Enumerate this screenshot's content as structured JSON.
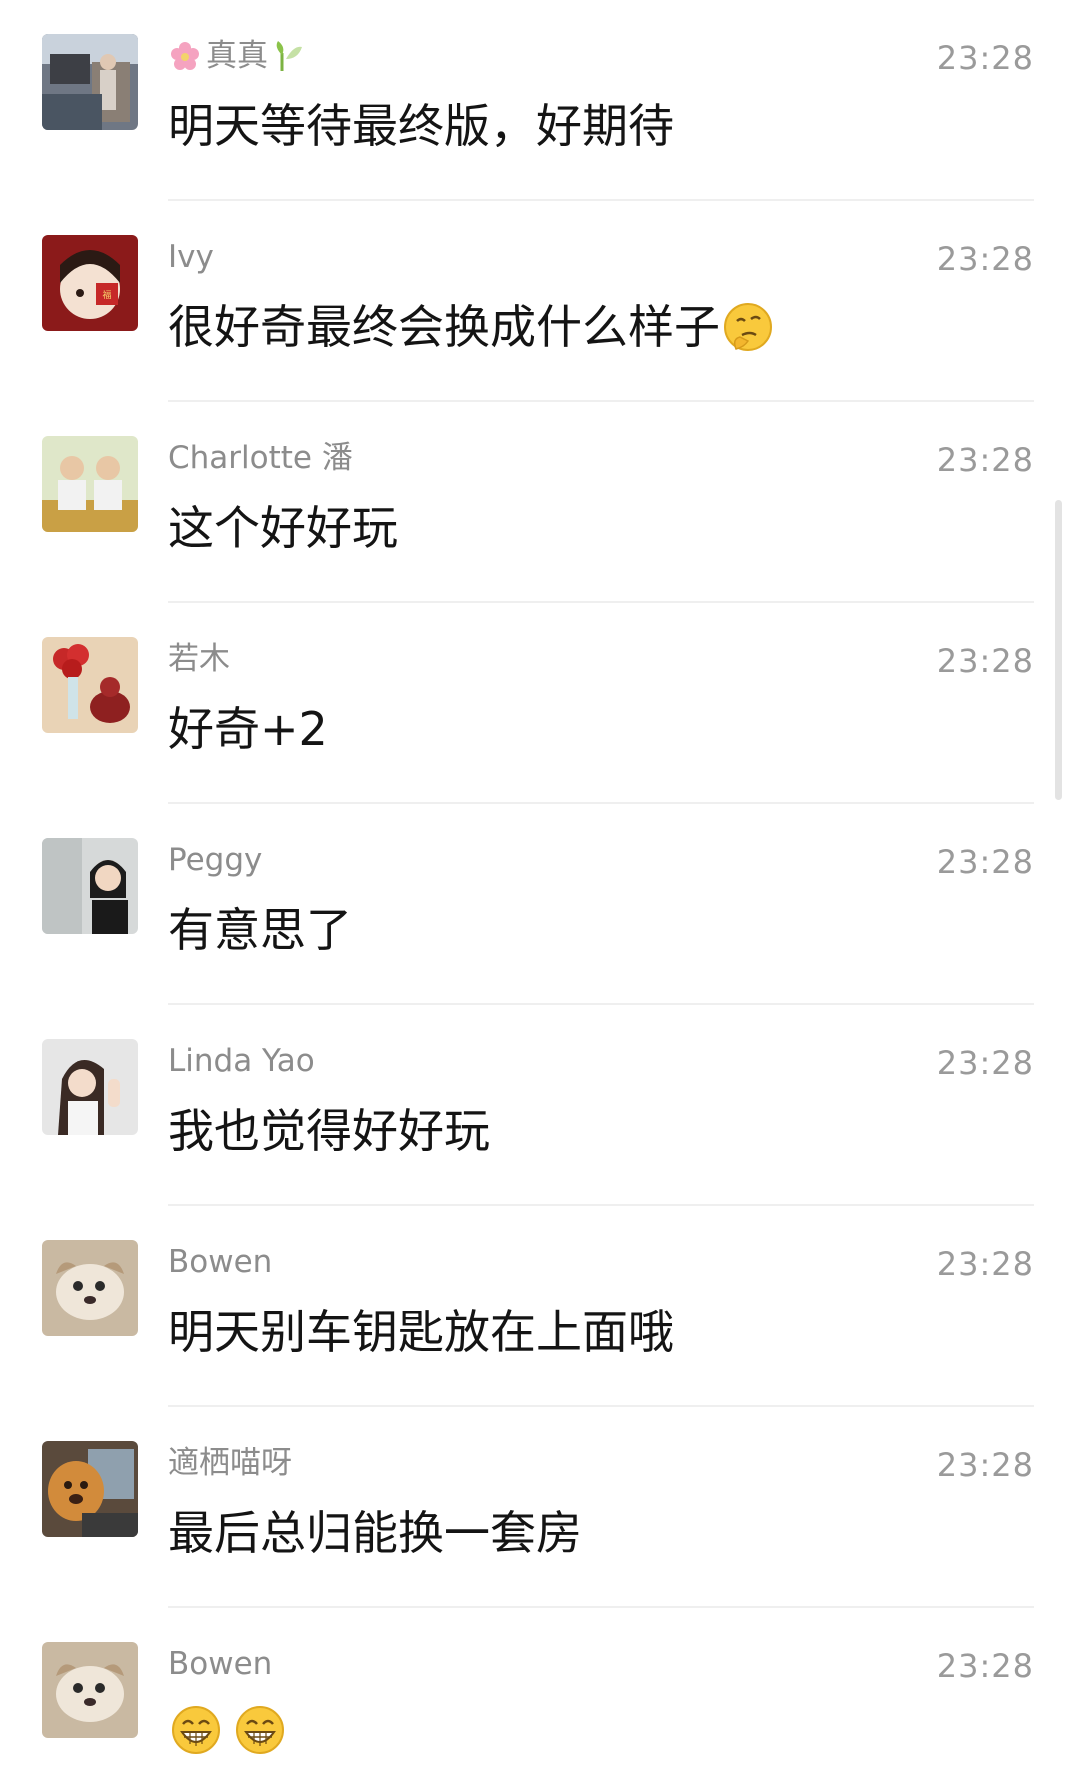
{
  "messages": [
    {
      "name": "真真",
      "time": "23:28",
      "text": "明天等待最终版，好期待",
      "avatar": "outdoor-crowd-avatar"
    },
    {
      "name": "Ivy",
      "time": "23:28",
      "text": "很好奇最终会换成什么样子",
      "avatar": "cartoon-girl-avatar",
      "emoji": "thinking-emoji"
    },
    {
      "name": "Charlotte 潘",
      "time": "23:28",
      "text": "这个好好玩",
      "avatar": "two-kids-avatar"
    },
    {
      "name": "若木",
      "time": "23:28",
      "text": "好奇+2",
      "avatar": "red-roses-avatar"
    },
    {
      "name": "Peggy",
      "time": "23:28",
      "text": "有意思了",
      "avatar": "woman-portrait-avatar"
    },
    {
      "name": "Linda Yao",
      "time": "23:28",
      "text": "我也觉得好好玩",
      "avatar": "woman-waving-avatar"
    },
    {
      "name": "Bowen",
      "time": "23:28",
      "text": "明天别车钥匙放在上面哦",
      "avatar": "dog-avatar"
    },
    {
      "name": "適栖喵呀",
      "time": "23:28",
      "text": "最后总归能换一套房",
      "avatar": "golden-dog-avatar"
    },
    {
      "name": "Bowen",
      "time": "23:28",
      "text": "",
      "avatar": "dog-avatar",
      "emojis": [
        "grin-emoji",
        "grin-emoji"
      ]
    }
  ],
  "colors": {
    "name": "#8c8c8c",
    "time": "#9a9a9a",
    "message": "#141414",
    "divider": "#efefef"
  }
}
